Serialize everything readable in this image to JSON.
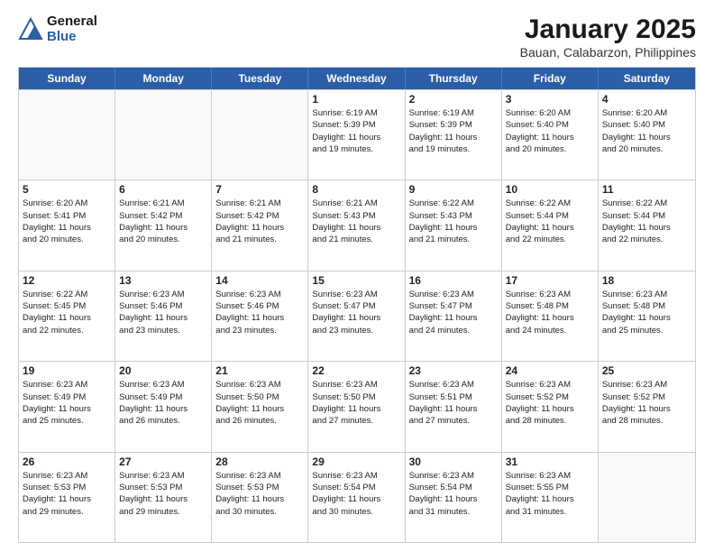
{
  "logo": {
    "general": "General",
    "blue": "Blue"
  },
  "header": {
    "title": "January 2025",
    "subtitle": "Bauan, Calabarzon, Philippines"
  },
  "weekdays": [
    "Sunday",
    "Monday",
    "Tuesday",
    "Wednesday",
    "Thursday",
    "Friday",
    "Saturday"
  ],
  "rows": [
    [
      {
        "day": "",
        "info": "",
        "empty": true
      },
      {
        "day": "",
        "info": "",
        "empty": true
      },
      {
        "day": "",
        "info": "",
        "empty": true
      },
      {
        "day": "1",
        "info": "Sunrise: 6:19 AM\nSunset: 5:39 PM\nDaylight: 11 hours\nand 19 minutes."
      },
      {
        "day": "2",
        "info": "Sunrise: 6:19 AM\nSunset: 5:39 PM\nDaylight: 11 hours\nand 19 minutes."
      },
      {
        "day": "3",
        "info": "Sunrise: 6:20 AM\nSunset: 5:40 PM\nDaylight: 11 hours\nand 20 minutes."
      },
      {
        "day": "4",
        "info": "Sunrise: 6:20 AM\nSunset: 5:40 PM\nDaylight: 11 hours\nand 20 minutes."
      }
    ],
    [
      {
        "day": "5",
        "info": "Sunrise: 6:20 AM\nSunset: 5:41 PM\nDaylight: 11 hours\nand 20 minutes."
      },
      {
        "day": "6",
        "info": "Sunrise: 6:21 AM\nSunset: 5:42 PM\nDaylight: 11 hours\nand 20 minutes."
      },
      {
        "day": "7",
        "info": "Sunrise: 6:21 AM\nSunset: 5:42 PM\nDaylight: 11 hours\nand 21 minutes."
      },
      {
        "day": "8",
        "info": "Sunrise: 6:21 AM\nSunset: 5:43 PM\nDaylight: 11 hours\nand 21 minutes."
      },
      {
        "day": "9",
        "info": "Sunrise: 6:22 AM\nSunset: 5:43 PM\nDaylight: 11 hours\nand 21 minutes."
      },
      {
        "day": "10",
        "info": "Sunrise: 6:22 AM\nSunset: 5:44 PM\nDaylight: 11 hours\nand 22 minutes."
      },
      {
        "day": "11",
        "info": "Sunrise: 6:22 AM\nSunset: 5:44 PM\nDaylight: 11 hours\nand 22 minutes."
      }
    ],
    [
      {
        "day": "12",
        "info": "Sunrise: 6:22 AM\nSunset: 5:45 PM\nDaylight: 11 hours\nand 22 minutes."
      },
      {
        "day": "13",
        "info": "Sunrise: 6:23 AM\nSunset: 5:46 PM\nDaylight: 11 hours\nand 23 minutes."
      },
      {
        "day": "14",
        "info": "Sunrise: 6:23 AM\nSunset: 5:46 PM\nDaylight: 11 hours\nand 23 minutes."
      },
      {
        "day": "15",
        "info": "Sunrise: 6:23 AM\nSunset: 5:47 PM\nDaylight: 11 hours\nand 23 minutes."
      },
      {
        "day": "16",
        "info": "Sunrise: 6:23 AM\nSunset: 5:47 PM\nDaylight: 11 hours\nand 24 minutes."
      },
      {
        "day": "17",
        "info": "Sunrise: 6:23 AM\nSunset: 5:48 PM\nDaylight: 11 hours\nand 24 minutes."
      },
      {
        "day": "18",
        "info": "Sunrise: 6:23 AM\nSunset: 5:48 PM\nDaylight: 11 hours\nand 25 minutes."
      }
    ],
    [
      {
        "day": "19",
        "info": "Sunrise: 6:23 AM\nSunset: 5:49 PM\nDaylight: 11 hours\nand 25 minutes."
      },
      {
        "day": "20",
        "info": "Sunrise: 6:23 AM\nSunset: 5:49 PM\nDaylight: 11 hours\nand 26 minutes."
      },
      {
        "day": "21",
        "info": "Sunrise: 6:23 AM\nSunset: 5:50 PM\nDaylight: 11 hours\nand 26 minutes."
      },
      {
        "day": "22",
        "info": "Sunrise: 6:23 AM\nSunset: 5:50 PM\nDaylight: 11 hours\nand 27 minutes."
      },
      {
        "day": "23",
        "info": "Sunrise: 6:23 AM\nSunset: 5:51 PM\nDaylight: 11 hours\nand 27 minutes."
      },
      {
        "day": "24",
        "info": "Sunrise: 6:23 AM\nSunset: 5:52 PM\nDaylight: 11 hours\nand 28 minutes."
      },
      {
        "day": "25",
        "info": "Sunrise: 6:23 AM\nSunset: 5:52 PM\nDaylight: 11 hours\nand 28 minutes."
      }
    ],
    [
      {
        "day": "26",
        "info": "Sunrise: 6:23 AM\nSunset: 5:53 PM\nDaylight: 11 hours\nand 29 minutes."
      },
      {
        "day": "27",
        "info": "Sunrise: 6:23 AM\nSunset: 5:53 PM\nDaylight: 11 hours\nand 29 minutes."
      },
      {
        "day": "28",
        "info": "Sunrise: 6:23 AM\nSunset: 5:53 PM\nDaylight: 11 hours\nand 30 minutes."
      },
      {
        "day": "29",
        "info": "Sunrise: 6:23 AM\nSunset: 5:54 PM\nDaylight: 11 hours\nand 30 minutes."
      },
      {
        "day": "30",
        "info": "Sunrise: 6:23 AM\nSunset: 5:54 PM\nDaylight: 11 hours\nand 31 minutes."
      },
      {
        "day": "31",
        "info": "Sunrise: 6:23 AM\nSunset: 5:55 PM\nDaylight: 11 hours\nand 31 minutes."
      },
      {
        "day": "",
        "info": "",
        "empty": true
      }
    ]
  ]
}
